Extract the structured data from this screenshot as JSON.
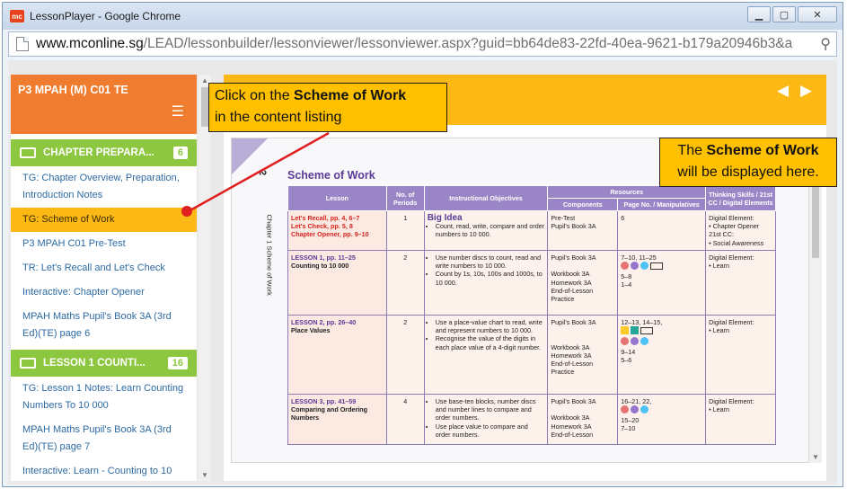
{
  "window": {
    "title": "LessonPlayer - Google Chrome",
    "logo_text": "mc",
    "minimize": "▁",
    "maximize": "▢",
    "close": "✕"
  },
  "address": {
    "host": "www.mconline.sg",
    "path": "/LEAD/lessonbuilder/lessonviewer/lessonviewer.aspx?guid=bb64de83-22fd-40ea-9621-b179a20946b3&a"
  },
  "sidebar": {
    "course_title": "P3 MPAH (M) C01 TE",
    "sections": [
      {
        "label": "CHAPTER PREPARA...",
        "count": "6",
        "items": [
          {
            "label": "TG: Chapter Overview, Preparation, Introduction Notes",
            "active": false
          },
          {
            "label": "TG: Scheme of Work",
            "active": true
          },
          {
            "label": "P3 MPAH C01 Pre-Test",
            "active": false
          },
          {
            "label": "TR: Let's Recall and Let's Check",
            "active": false
          },
          {
            "label": "Interactive: Chapter Opener",
            "active": false
          },
          {
            "label": "MPAH Maths Pupil's Book 3A (3rd Ed)(TE) page 6",
            "active": false
          }
        ]
      },
      {
        "label": "LESSON 1 COUNTI...",
        "count": "16",
        "items": [
          {
            "label": "TG: Lesson 1 Notes: Learn Counting Numbers To 10 000",
            "active": false
          },
          {
            "label": "MPAH Maths Pupil's Book 3A (3rd Ed)(TE) page 7",
            "active": false
          },
          {
            "label": "Interactive: Learn - Counting to 10 000",
            "active": false
          }
        ]
      }
    ]
  },
  "document": {
    "chapter_number": "2",
    "chapter_side": "Chapter 1  Scheme of Work",
    "title": "Scheme of Work",
    "headers": {
      "lesson": "Lesson",
      "periods": "No. of Periods",
      "objectives": "Instructional Objectives",
      "resources": "Resources",
      "components": "Components",
      "page_no": "Page No. / Manipulatives",
      "thinking": "Thinking Skills / 21st CC / Digital Elements"
    },
    "rows": [
      {
        "lesson_lines": [
          "Let's Recall, pp. 4, 6–7",
          "Let's Check, pp. 5, 8",
          "Chapter Opener, pp. 9–10"
        ],
        "periods": "1",
        "big_idea": "Big Idea",
        "objectives": [
          "Count, read, write, compare and order numbers to 10 000."
        ],
        "components": [
          "Pre-Test",
          "Pupil's Book 3A"
        ],
        "pages": [
          "",
          "6"
        ],
        "thinking": [
          "Digital Element:",
          "• Chapter Opener",
          "21st CC:",
          "• Social Awareness"
        ]
      },
      {
        "lesson_lines": [
          "LESSON 1, pp. 11–25",
          "Counting to 10 000"
        ],
        "periods": "2",
        "big_idea": "",
        "objectives": [
          "Use number discs to count, read and write numbers to 10 000.",
          "Count by 1s, 10s, 100s and 1000s, to 10 000."
        ],
        "components": [
          "Pupil's Book 3A",
          "",
          "Workbook 3A",
          "Homework 3A",
          "End-of-Lesson",
          "Practice"
        ],
        "pages": [
          "7–10, 11–25",
          "",
          "5–8",
          "1–4"
        ],
        "thinking": [
          "Digital Element:",
          "• Learn"
        ]
      },
      {
        "lesson_lines": [
          "LESSON 2, pp. 26–40",
          "Place Values"
        ],
        "periods": "2",
        "big_idea": "",
        "objectives": [
          "Use a place-value chart to read, write and represent numbers to 10 000.",
          "Recognise the value of the digits in each place value of a 4-digit number."
        ],
        "components": [
          "Pupil's Book 3A",
          "",
          "",
          "Workbook 3A",
          "Homework 3A",
          "End-of-Lesson",
          "Practice"
        ],
        "pages": [
          "12–13, 14–15,",
          "",
          "",
          "9–14",
          "5–6"
        ],
        "thinking": [
          "Digital Element:",
          "• Learn"
        ]
      },
      {
        "lesson_lines": [
          "LESSON 3, pp. 41–59",
          "Comparing and Ordering Numbers"
        ],
        "periods": "4",
        "big_idea": "",
        "objectives": [
          "Use base-ten blocks, number discs and number lines to compare and order numbers.",
          "Use place value to compare and order numbers."
        ],
        "components": [
          "Pupil's Book 3A",
          "",
          "Workbook 3A",
          "Homework 3A",
          "End-of-Lesson"
        ],
        "pages": [
          "16–21, 22,",
          "",
          "15–20",
          "7–10"
        ],
        "thinking": [
          "Digital Element:",
          "• Learn"
        ]
      }
    ]
  },
  "callouts": {
    "left_pre": "Click on the ",
    "left_bold": "Scheme of Work",
    "left_post": "in the content listing",
    "right_pre": "The ",
    "right_bold": "Scheme of Work",
    "right_post": "will be displayed here."
  },
  "colors": {
    "orange": "#f07d2f",
    "green": "#8dc63f",
    "yellow": "#fcb814",
    "link": "#2d6aa3",
    "purple": "#5a3b96",
    "callout": "#ffc000"
  }
}
